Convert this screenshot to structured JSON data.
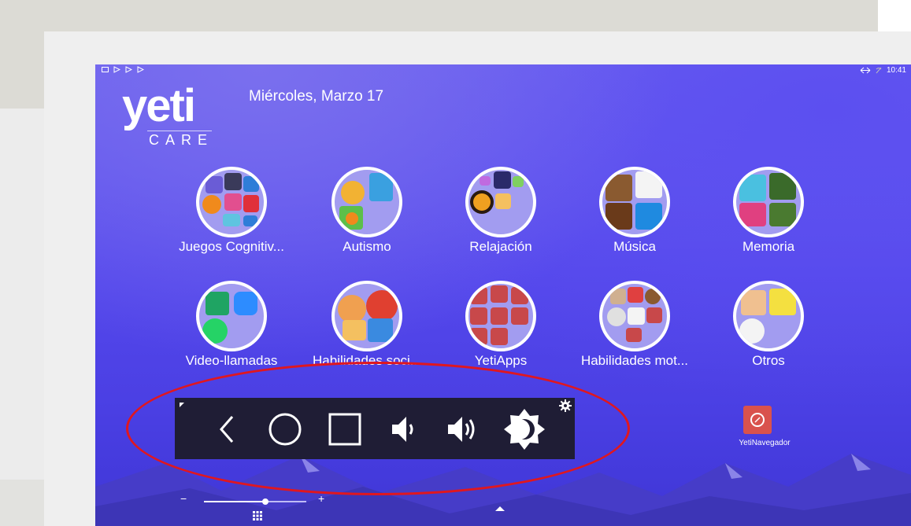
{
  "date": "Miércoles, Marzo 17",
  "logo": {
    "main": "yeti",
    "sub": "CARE"
  },
  "status": {
    "time": "10:41"
  },
  "apps": [
    {
      "label": "Juegos Cognitiv..."
    },
    {
      "label": "Autismo"
    },
    {
      "label": "Relajación"
    },
    {
      "label": "Música"
    },
    {
      "label": "Memoria"
    },
    {
      "label": "Video-llamadas"
    },
    {
      "label": "Habilidades soci..."
    },
    {
      "label": "YetiApps"
    },
    {
      "label": "Habilidades mot..."
    },
    {
      "label": "Otros"
    }
  ],
  "browser": {
    "label": "YetiNavegador"
  },
  "slider": {
    "minus": "−",
    "plus": "+",
    "level": 0.6
  },
  "navbar": {
    "buttons": [
      "back-icon",
      "home-icon",
      "recents-icon",
      "volume-down-icon",
      "volume-up-icon",
      "brightness-icon",
      "gear-icon"
    ]
  },
  "colors": {
    "accent": "#e0171f",
    "tablet": "#5548ec",
    "navbar": "#1f1d35"
  }
}
